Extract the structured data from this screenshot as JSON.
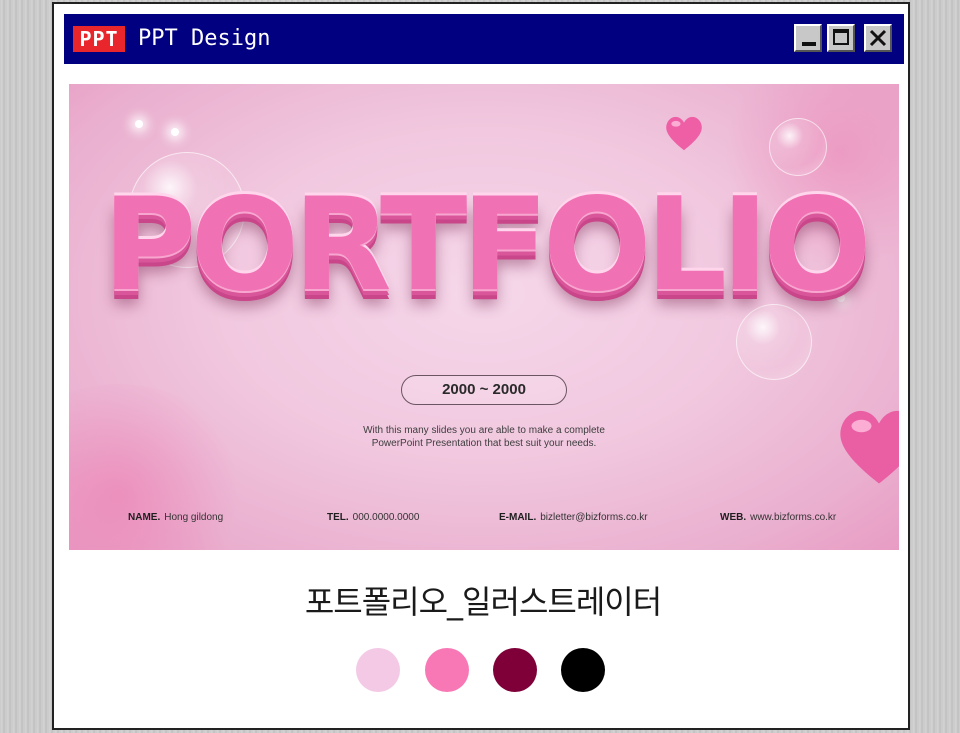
{
  "window": {
    "logo_text": "PPT",
    "title": "PPT Design",
    "controls": {
      "minimize": "minimize-icon",
      "maximize": "maximize-icon",
      "close": "close-icon"
    }
  },
  "slide": {
    "headline": "PORTFOLIO",
    "date_range": "2000 ~ 2000",
    "tagline_line1": "With this many slides you are able to make a complete",
    "tagline_line2": "PowerPoint Presentation that best suit your needs.",
    "contacts": {
      "name_label": "NAME.",
      "name_value": "Hong gildong",
      "tel_label": "TEL.",
      "tel_value": "000.0000.0000",
      "email_label": "E-MAIL.",
      "email_value": "bizletter@bizforms.co.kr",
      "web_label": "WEB.",
      "web_value": "www.bizforms.co.kr"
    }
  },
  "caption": "포트폴리오_일러스트레이터",
  "palette": [
    "#f3c9e6",
    "#f878b5",
    "#7f0039",
    "#000000"
  ],
  "colors": {
    "titlebar": "#000080",
    "logo_bg": "#e8262b",
    "headline": "#f071b4"
  }
}
